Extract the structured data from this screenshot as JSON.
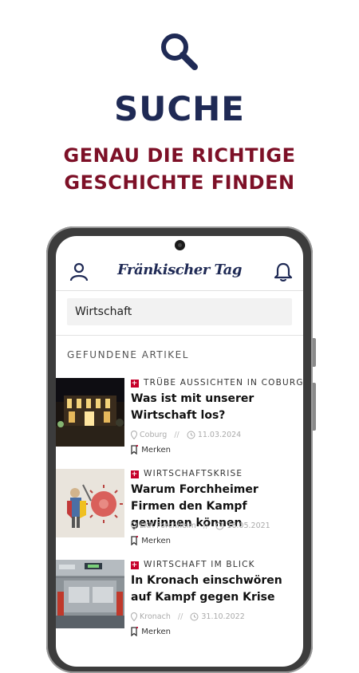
{
  "promo": {
    "title": "SUCHE",
    "subtitle_line1": "GENAU DIE RICHTIGE",
    "subtitle_line2": "GESCHICHTE FINDEN"
  },
  "app": {
    "logo": "Fränkischer Tag",
    "search": {
      "value": "Wirtschaft"
    },
    "section_label": "GEFUNDENE ARTIKEL"
  },
  "articles": [
    {
      "kicker": "TRÜBE AUSSICHTEN IN COBURG",
      "headline": "Was ist mit unserer Wirtschaft los?",
      "location": "Coburg",
      "date": "11.03.2024",
      "save_label": "Merken"
    },
    {
      "kicker": "WIRTSCHAFTSKRISE",
      "headline": "Warum Forchheimer Firmen den Kampf gewinnen können",
      "location": "LKR Forchheim",
      "date": "16.05.2021",
      "save_label": "Merken"
    },
    {
      "kicker": "WIRTSCHAFT IM BLICK",
      "headline": "In Kronach einschwören auf Kampf gegen Krise",
      "location": "Kronach",
      "date": "31.10.2022",
      "save_label": "Merken"
    }
  ],
  "colors": {
    "navy": "#1f2a55",
    "burgundy": "#7d1027",
    "badge_red": "#c6002a"
  },
  "icons": [
    "search-icon",
    "user-icon",
    "bell-icon",
    "location-pin-icon",
    "clock-icon",
    "bookmark-icon",
    "swiss-cross-badge-icon"
  ]
}
